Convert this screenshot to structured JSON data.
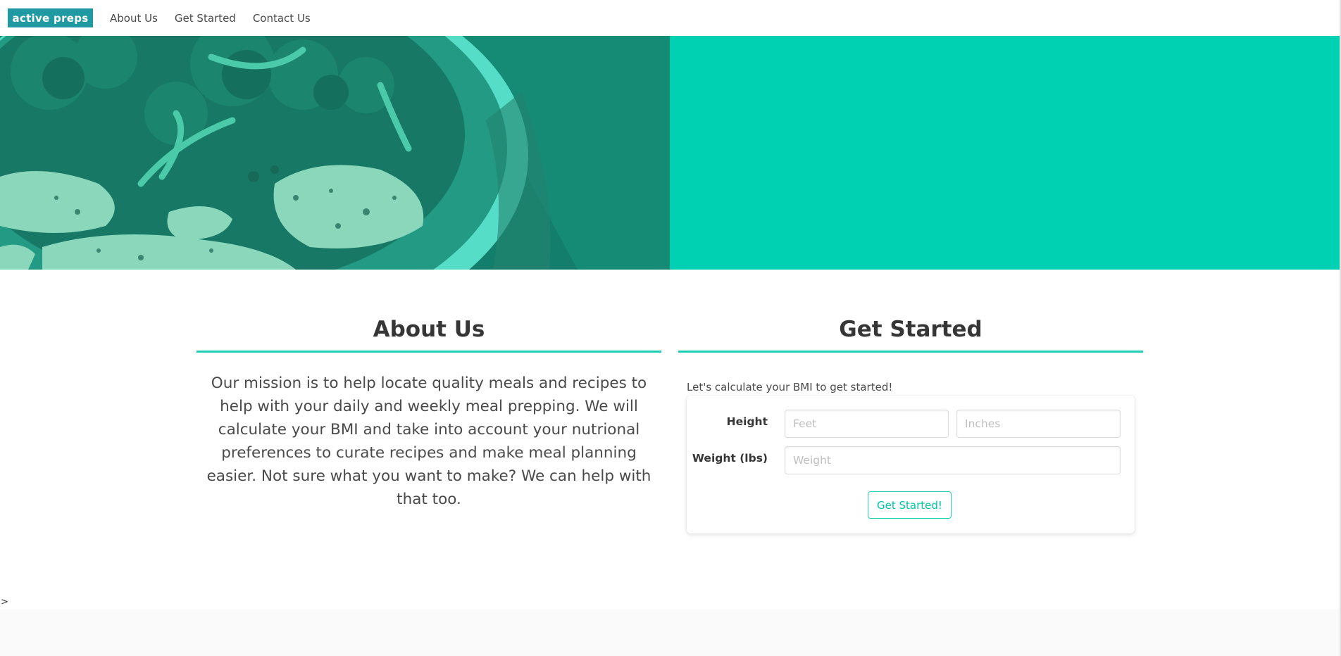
{
  "nav": {
    "logo": "active preps",
    "links": [
      "About Us",
      "Get Started",
      "Contact Us"
    ]
  },
  "colors": {
    "brand": "#1f9aa3",
    "accent": "#00d1b2",
    "hero_overlay": "#1a7566"
  },
  "about": {
    "title": "About Us",
    "text": "Our mission is to help locate quality meals and recipes to help with your daily and weekly meal prepping. We will calculate your BMI and take into account your nutrional preferences to curate recipes and make meal planning easier. Not sure what you want to make? We can help with that too."
  },
  "get_started": {
    "title": "Get Started",
    "intro": "Let's calculate your BMI to get started!",
    "height_label": "Height",
    "feet_placeholder": "Feet",
    "inches_placeholder": "Inches",
    "weight_label": "Weight (lbs)",
    "weight_placeholder": "Weight",
    "button_label": "Get Started!"
  },
  "stray_char": ">"
}
